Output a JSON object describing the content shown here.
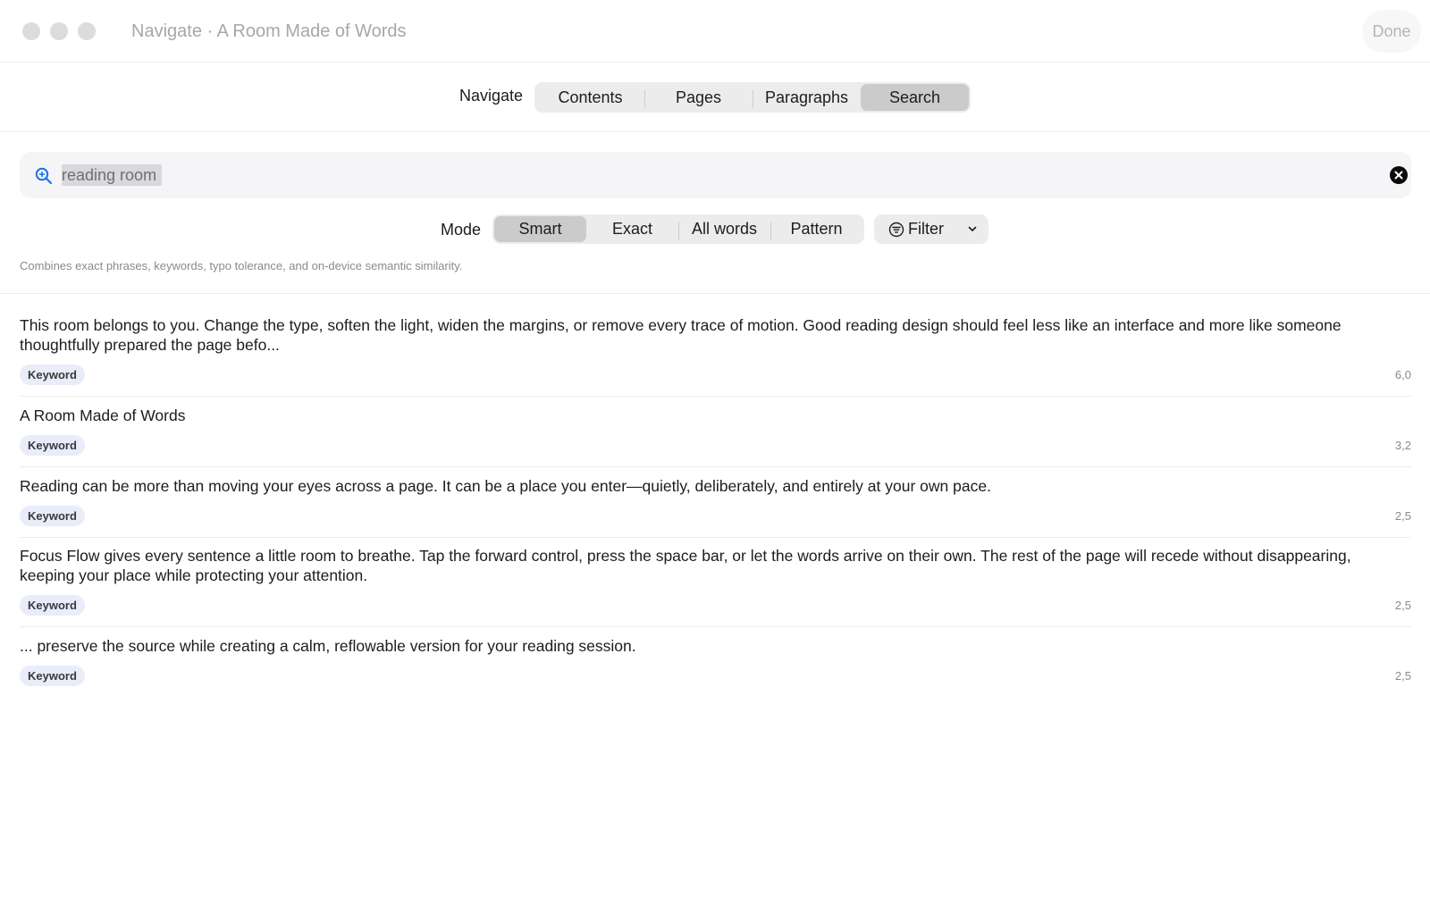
{
  "window": {
    "title": "Navigate · A Room Made of Words",
    "done_label": "Done"
  },
  "navigate": {
    "label": "Navigate",
    "tabs": [
      {
        "label": "Contents"
      },
      {
        "label": "Pages"
      },
      {
        "label": "Paragraphs"
      },
      {
        "label": "Search"
      }
    ],
    "active_tab": "Search"
  },
  "search": {
    "value": "reading room",
    "placeholder": "Search"
  },
  "mode": {
    "label": "Mode",
    "options": [
      {
        "label": "Smart"
      },
      {
        "label": "Exact"
      },
      {
        "label": "All words"
      },
      {
        "label": "Pattern"
      }
    ],
    "active": "Smart",
    "filter_label": "Filter",
    "hint": "Combines exact phrases, keywords, typo tolerance, and on-device semantic similarity."
  },
  "results": [
    {
      "text": "This room belongs to you. Change the type, soften the light, widen the margins, or remove every trace of motion. Good reading design should feel less like an interface and more like someone thoughtfully prepared the page befo...",
      "badge": "Keyword",
      "score": "6,0"
    },
    {
      "text": "A Room Made of Words",
      "badge": "Keyword",
      "score": "3,2"
    },
    {
      "text": "Reading can be more than moving your eyes across a page. It can be a place you enter—quietly, deliberately, and entirely at your own pace.",
      "badge": "Keyword",
      "score": "2,5"
    },
    {
      "text": "Focus Flow gives every sentence a little room to breathe. Tap the forward control, press the space bar, or let the words arrive on their own. The rest of the page will recede without disappearing, keeping your place while protecting your attention.",
      "badge": "Keyword",
      "score": "2,5"
    },
    {
      "text": "... preserve the source while creating a calm, reflowable version for your reading session.",
      "badge": "Keyword",
      "score": "2,5"
    }
  ],
  "colors": {
    "accent": "#1a73e8",
    "badge_bg": "#e9ecf9",
    "segment_active": "#cbcbcb"
  }
}
